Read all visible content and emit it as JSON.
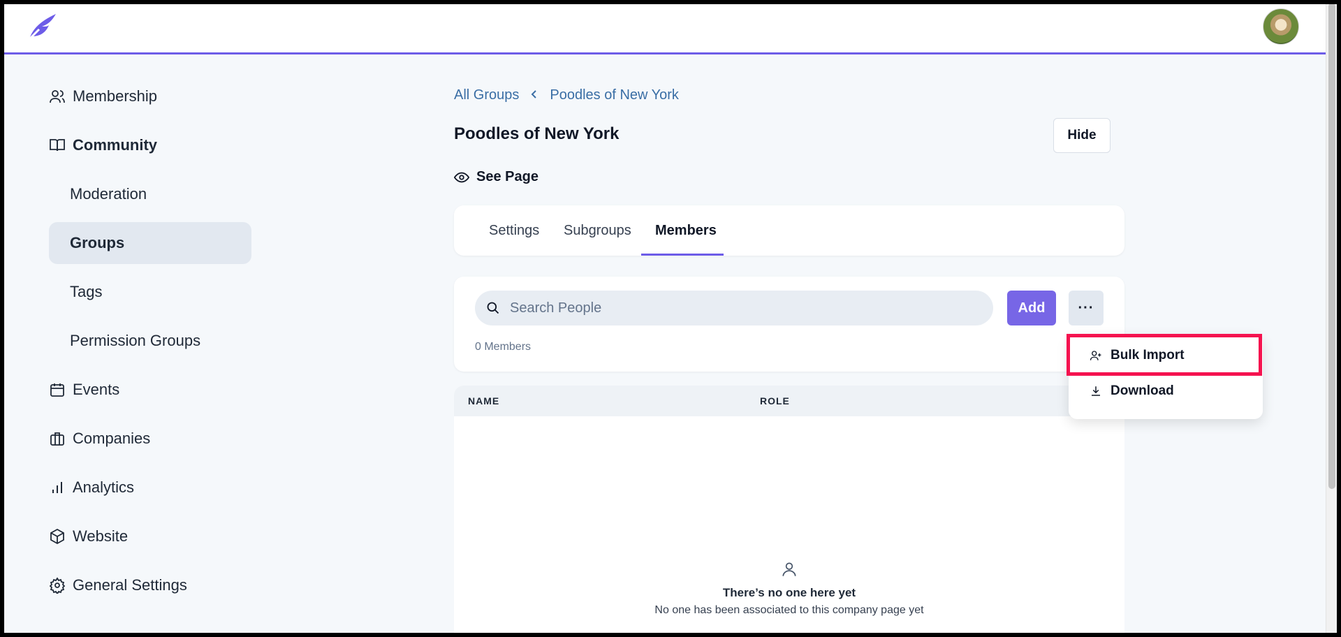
{
  "header": {
    "logo_icon": "feather-logo-icon",
    "avatar_icon": "user-avatar"
  },
  "sidebar": {
    "items": [
      {
        "label": "Membership",
        "icon": "users-icon"
      },
      {
        "label": "Community",
        "icon": "book-open-icon"
      },
      {
        "label": "Moderation"
      },
      {
        "label": "Groups"
      },
      {
        "label": "Tags"
      },
      {
        "label": "Permission Groups"
      },
      {
        "label": "Events",
        "icon": "calendar-icon"
      },
      {
        "label": "Companies",
        "icon": "briefcase-icon"
      },
      {
        "label": "Analytics",
        "icon": "bar-chart-icon"
      },
      {
        "label": "Website",
        "icon": "cube-icon"
      },
      {
        "label": "General Settings",
        "icon": "gear-icon"
      }
    ],
    "active": "Groups"
  },
  "breadcrumb": {
    "root": "All Groups",
    "current": "Poodles of New York"
  },
  "page": {
    "title": "Poodles of New York",
    "hide_label": "Hide",
    "see_page_label": "See Page"
  },
  "tabs": [
    {
      "label": "Settings"
    },
    {
      "label": "Subgroups"
    },
    {
      "label": "Members",
      "active": true
    }
  ],
  "members": {
    "search_placeholder": "Search People",
    "add_label": "Add",
    "more_label": "···",
    "count_label": "0 Members"
  },
  "table": {
    "columns": [
      "NAME",
      "ROLE"
    ],
    "empty_title": "There’s no one here yet",
    "empty_subtitle": "No one has been associated to this company page yet"
  },
  "dropdown": {
    "items": [
      {
        "label": "Bulk Import",
        "icon": "user-plus-icon"
      },
      {
        "label": "Download",
        "icon": "download-icon"
      }
    ]
  },
  "colors": {
    "accent": "#6d5ce8",
    "link": "#3a6ea5",
    "highlight": "#f5124f"
  }
}
